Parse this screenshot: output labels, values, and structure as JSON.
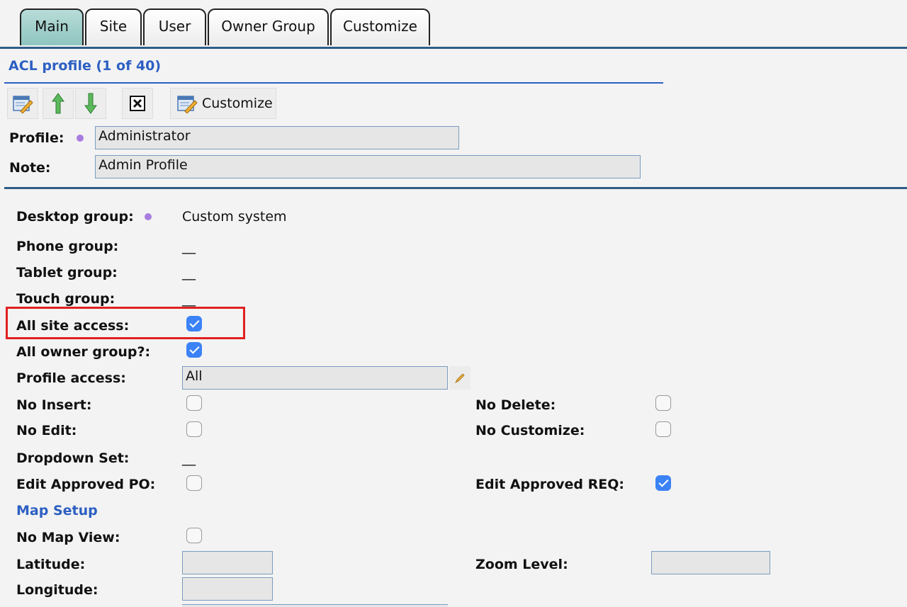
{
  "tabs": [
    "Main",
    "Site",
    "User",
    "Owner Group",
    "Customize"
  ],
  "header": {
    "title": "ACL profile (1 of 40)"
  },
  "toolbar": {
    "customize_label": "Customize"
  },
  "profile": {
    "label": "Profile:",
    "value": "Administrator"
  },
  "note": {
    "label": "Note:",
    "value": "Admin Profile"
  },
  "fields": {
    "desktop_group": {
      "label": "Desktop group:",
      "value": "Custom system"
    },
    "phone_group": {
      "label": "Phone group:",
      "value": "__"
    },
    "tablet_group": {
      "label": "Tablet group:",
      "value": "__"
    },
    "touch_group": {
      "label": "Touch group:",
      "value": "__"
    },
    "all_site_access": {
      "label": "All site access:",
      "checked": true
    },
    "all_owner_group": {
      "label": "All owner group?:",
      "checked": true
    },
    "profile_access": {
      "label": "Profile access:",
      "value": "All"
    },
    "no_insert": {
      "label": "No Insert:",
      "checked": false
    },
    "no_delete": {
      "label": "No Delete:",
      "checked": false
    },
    "no_edit": {
      "label": "No Edit:",
      "checked": false
    },
    "no_customize": {
      "label": "No Customize:",
      "checked": false
    },
    "dropdown_set": {
      "label": "Dropdown Set:",
      "value": "__"
    },
    "edit_approved_po": {
      "label": "Edit Approved PO:",
      "checked": false
    },
    "edit_approved_req": {
      "label": "Edit Approved REQ:",
      "checked": true
    },
    "no_map_view": {
      "label": "No Map View:",
      "checked": false
    },
    "latitude": {
      "label": "Latitude:",
      "value": ""
    },
    "zoom_level": {
      "label": "Zoom Level:",
      "value": ""
    },
    "longitude": {
      "label": "Longitude:",
      "value": ""
    }
  },
  "sections": {
    "map_setup": "Map Setup"
  },
  "colors": {
    "accent": "#2c5fc2",
    "active_tab": "#a8d4cf",
    "checkbox_on": "#3b82f6",
    "highlight": "#e02020",
    "required_dot": "#a77de0"
  }
}
